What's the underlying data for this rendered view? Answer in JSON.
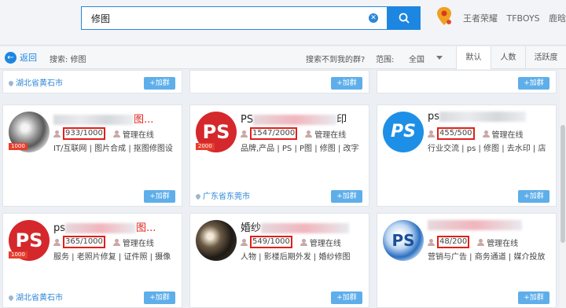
{
  "header": {
    "search_value": "修图",
    "hot_words": [
      "王者荣耀",
      "TFBOYS",
      "鹿晗"
    ]
  },
  "filter": {
    "back_label": "返回",
    "search_label": "搜索: 修图",
    "not_found": "搜索不到我的群?",
    "range_label": "范围:",
    "range_value": "全国",
    "sort_tabs": [
      "默认",
      "人数",
      "活跃度"
    ]
  },
  "cards": [
    {
      "location": "湖北省黄石市",
      "join": "+加群"
    },
    {
      "location": "",
      "join": "+加群"
    },
    {
      "location": "",
      "join": "+加群"
    },
    {
      "name_tail": "图...",
      "members": "933/1000",
      "admin": "管理在线",
      "tags": "IT/互联网 | 图片合成 | 抠图修图设",
      "level": "1000",
      "location": "",
      "join": "+加群"
    },
    {
      "name_head": "PS",
      "name_tail": "印",
      "members": "1547/2000",
      "admin": "管理在线",
      "tags": "品牌,产品 | PS | P图 | 修图 | 改字",
      "level": "2000",
      "location": "广东省东莞市",
      "join": "+加群"
    },
    {
      "name_head": "ps",
      "name_tail": "",
      "members": "455/500",
      "admin": "管理在线",
      "tags": "行业交流 | ps | 修图 | 去水印 | 店",
      "level": "",
      "location": "",
      "join": "+加群"
    },
    {
      "name_head": "ps",
      "name_tail": "图...",
      "members": "365/1000",
      "admin": "管理在线",
      "tags": "服务 | 老照片修复 | 证件照 | 摄像",
      "level": "1000",
      "location": "湖北省黄石市",
      "join": "+加群"
    },
    {
      "name_head": "婚纱",
      "name_tail": "",
      "members": "549/1000",
      "admin": "管理在线",
      "tags": "人物 | 影楼后期外发 | 婚纱修图",
      "level": "",
      "location": "",
      "join": "+加群"
    },
    {
      "name_head": "",
      "name_tail": "",
      "members": "48/200",
      "admin": "管理在线",
      "tags": "营销与广告 | 商务通道 | 媒介投放",
      "level": "",
      "location": "",
      "join": "+加群"
    }
  ]
}
